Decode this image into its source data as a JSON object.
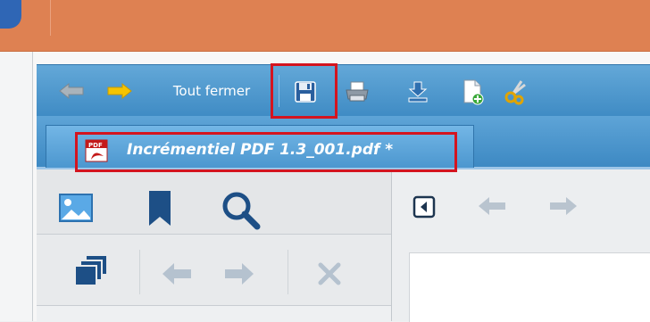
{
  "toolbar": {
    "close_all_label": "Tout fermer",
    "icons": [
      "back-arrow-icon",
      "forward-arrow-icon",
      "save-icon",
      "print-icon",
      "download-icon",
      "new-document-icon",
      "cut-icon"
    ]
  },
  "tab": {
    "title": "Incrémentiel PDF 1.3_001.pdf *",
    "file_icon_text": "PDF"
  },
  "left_panel": {
    "top_icons": [
      "image-thumbnails-icon",
      "bookmark-icon",
      "search-icon"
    ],
    "second_icons": [
      "layers-icon",
      "undo-icon",
      "redo-icon",
      "close-icon"
    ]
  },
  "viewer": {
    "nav_icons": [
      "collapse-panel-icon",
      "previous-arrow-icon",
      "next-arrow-icon"
    ]
  },
  "colors": {
    "title_bar": "#de8152",
    "toolbar_blue": "#4a95cc",
    "highlight_red": "#d4141f",
    "icon_dark_blue": "#1d4f86"
  }
}
